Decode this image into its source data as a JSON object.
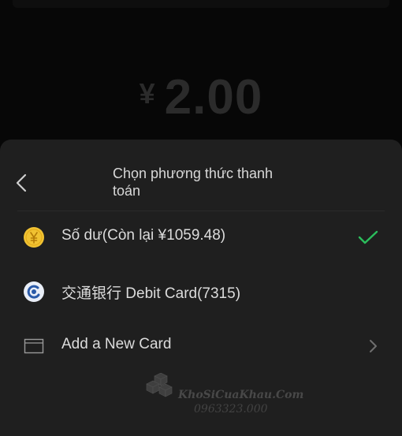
{
  "amount": {
    "currency": "¥",
    "value": "2.00"
  },
  "sheet": {
    "title": "Chọn phương thức thanh toán",
    "methods": [
      {
        "label": "Số dư(Còn lại ¥1059.48)",
        "icon": "coin-yen-icon",
        "selected": true
      },
      {
        "label": "交通银行 Debit Card(7315)",
        "icon": "bank-logo-icon",
        "selected": false
      },
      {
        "label": "Add a New Card",
        "icon": "card-icon",
        "selected": false
      }
    ]
  },
  "watermark": {
    "brand": "KhoSiCuaKhau.Com",
    "phone": "0963323.000"
  },
  "colors": {
    "check": "#2bbd5c",
    "sheet_bg": "#1f1f1f",
    "coin": "#f0c232",
    "bank": "#2a5aa8"
  }
}
